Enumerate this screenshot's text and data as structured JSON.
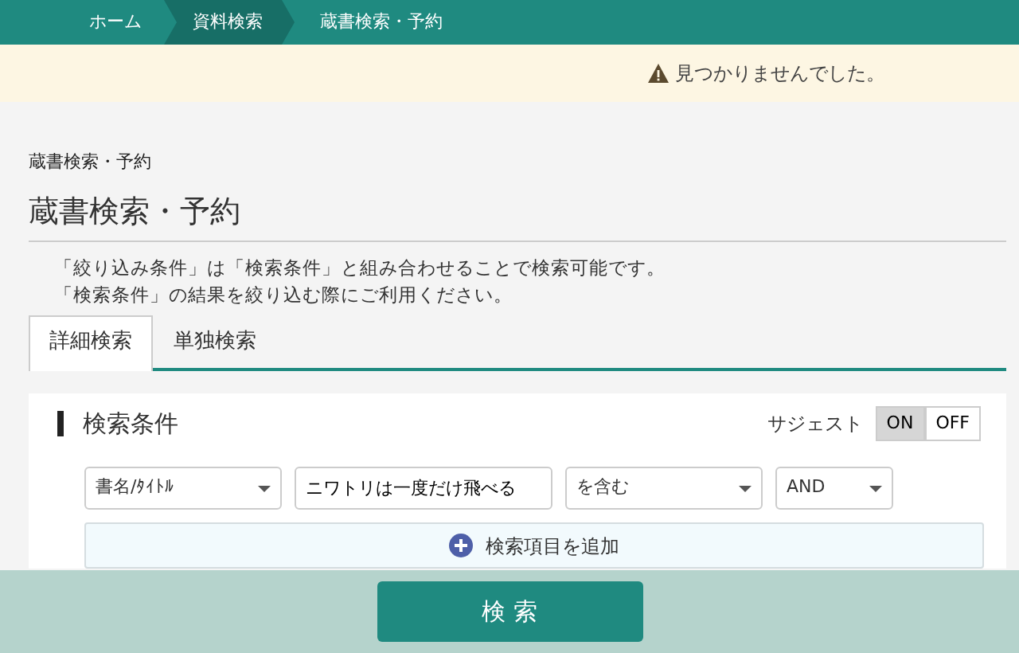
{
  "breadcrumb": [
    {
      "label": "ホーム",
      "highlighted": false
    },
    {
      "label": "資料検索",
      "highlighted": true
    },
    {
      "label": "蔵書検索・予約",
      "highlighted": false
    }
  ],
  "alert": {
    "message": "見つかりませんでした。"
  },
  "page": {
    "small_title": "蔵書検索・予約",
    "title": "蔵書検索・予約",
    "notes": [
      "「絞り込み条件」は「検索条件」と組み合わせることで検索可能です。",
      "「検索条件」の結果を絞り込む際にご利用ください。"
    ]
  },
  "tabs": [
    {
      "label": "詳細検索",
      "selected": true
    },
    {
      "label": "単独検索",
      "selected": false
    }
  ],
  "panel": {
    "heading": "検索条件",
    "suggest_label": "サジェスト",
    "suggest_options": [
      {
        "label": "ON",
        "selected": true
      },
      {
        "label": "OFF",
        "selected": false
      }
    ],
    "row": [
      {
        "kind": "select",
        "value": "書名/ﾀｲﾄﾙ"
      },
      {
        "kind": "input",
        "value": "ニワトリは一度だけ飛べる"
      },
      {
        "kind": "select",
        "value": "を含む"
      },
      {
        "kind": "select",
        "value": "AND"
      }
    ],
    "add_button": "検索項目を追加"
  },
  "search_button": "検 索"
}
